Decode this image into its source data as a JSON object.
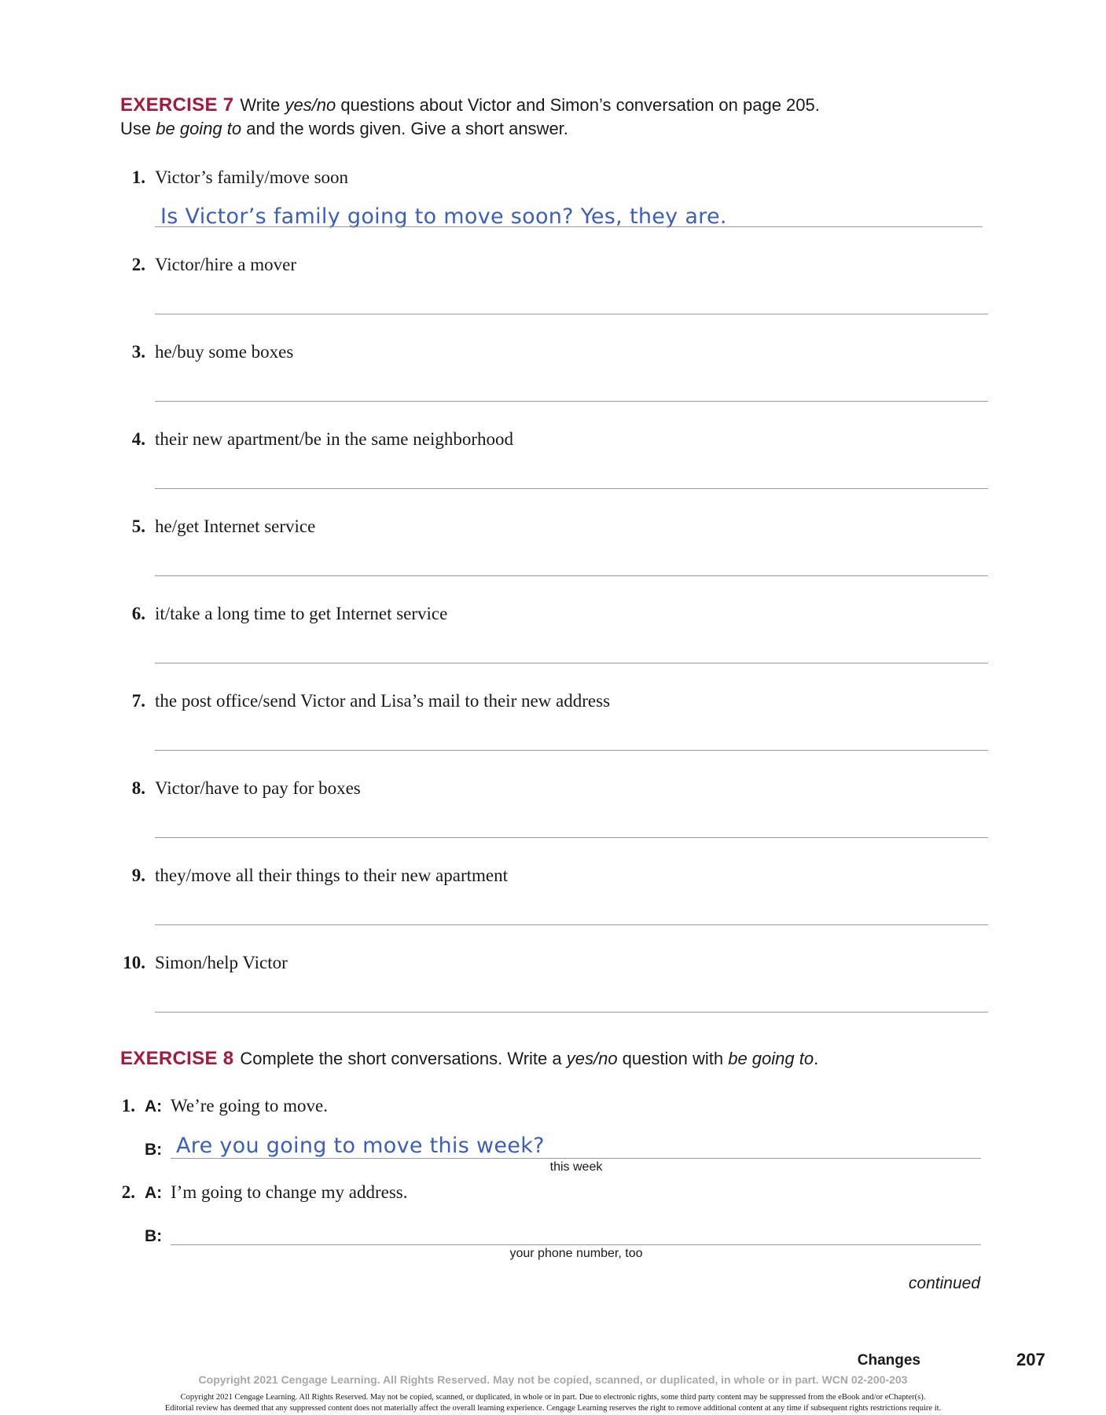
{
  "exercise7": {
    "label": "EXERCISE 7",
    "instr_a": "Write ",
    "instr_a_italic": "yes/no",
    "instr_b": " questions about Victor and Simon’s conversation on page 205.",
    "instr_c": "Use ",
    "instr_c_italic": "be going to",
    "instr_d": " and the words given. Give a short answer.",
    "items": [
      {
        "num": "1.",
        "prompt": "Victor’s family/move soon",
        "answer": "Is Victor’s family going to move soon? Yes, they are."
      },
      {
        "num": "2.",
        "prompt": "Victor/hire a mover",
        "answer": ""
      },
      {
        "num": "3.",
        "prompt": "he/buy some boxes",
        "answer": ""
      },
      {
        "num": "4.",
        "prompt": "their new apartment/be in the same neighborhood",
        "answer": ""
      },
      {
        "num": "5.",
        "prompt": "he/get Internet service",
        "answer": ""
      },
      {
        "num": "6.",
        "prompt": "it/take a long time to get Internet service",
        "answer": ""
      },
      {
        "num": "7.",
        "prompt": "the post office/send Victor and Lisa’s mail to their new address",
        "answer": ""
      },
      {
        "num": "8.",
        "prompt": "Victor/have to pay for boxes",
        "answer": ""
      },
      {
        "num": "9.",
        "prompt": "they/move all their things to their new apartment",
        "answer": ""
      },
      {
        "num": "10.",
        "prompt": "Simon/help Victor",
        "answer": ""
      }
    ]
  },
  "exercise8": {
    "label": "EXERCISE 8",
    "instr_a": "Complete the short conversations. Write a ",
    "instr_a_italic": "yes/no",
    "instr_b": " question with ",
    "instr_b_italic": "be going to",
    "instr_c": ".",
    "conversations": [
      {
        "num": "1.",
        "a_label": "A:",
        "a_text": "We’re going to move.",
        "b_label": "B:",
        "b_answer": "Are you going to move this week?",
        "cue": "this week"
      },
      {
        "num": "2.",
        "a_label": "A:",
        "a_text": "I’m going to change my address.",
        "b_label": "B:",
        "b_answer": "",
        "cue": "your phone number, too"
      }
    ]
  },
  "continued": "continued",
  "footer": {
    "section": "Changes",
    "page": "207",
    "copyright_gray": "Copyright 2021 Cengage Learning. All Rights Reserved. May not be copied, scanned, or duplicated, in whole or in part.  WCN 02-200-203",
    "copyright_line1": "Copyright 2021 Cengage Learning. All Rights Reserved. May not be copied, scanned, or duplicated, in whole or in part. Due to electronic rights, some third party content may be suppressed from the eBook and/or eChapter(s).",
    "copyright_line2": "Editorial review has deemed that any suppressed content does not materially affect the overall learning experience. Cengage Learning reserves the right to remove additional content at any time if subsequent rights restrictions require it."
  }
}
